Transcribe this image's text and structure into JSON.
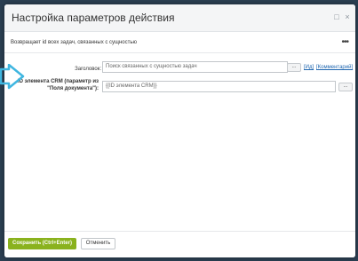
{
  "dialog": {
    "title": "Настройка параметров действия",
    "minimize_glyph": "□",
    "close_glyph": "×",
    "description": "Возвращает id всех задач, связанных с сущностью",
    "more_glyph": "•••"
  },
  "form": {
    "title_label": "Заголовок:",
    "title_value": "Поиск связанных с сущностью задач",
    "title_dots": "...",
    "link_id": "[Ид]",
    "link_comment": "[Комментарий]",
    "crm_label_line1": "ID элемента CRM (параметр из",
    "crm_label_line2": "\"Поля документа\"):",
    "crm_value": "{{ID элемента CRM}}",
    "crm_dots": "..."
  },
  "footer": {
    "save_label": "Сохранить (Ctrl+Enter)",
    "cancel_label": "Отменить"
  },
  "colors": {
    "save_button": "#8ab21e",
    "arrow": "#3fb6e0",
    "backdrop": "#2b3f52"
  }
}
